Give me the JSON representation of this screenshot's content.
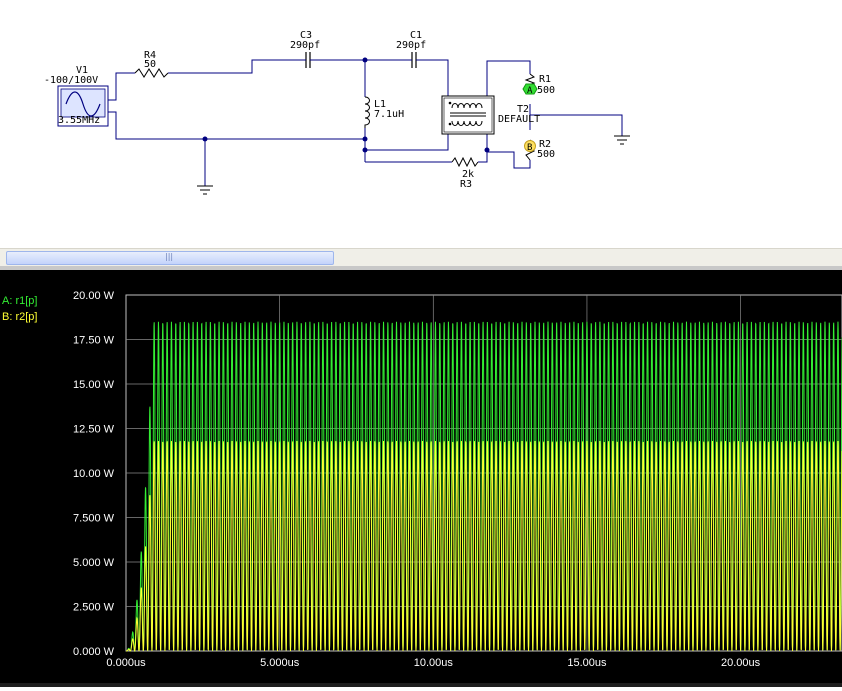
{
  "schematic": {
    "components": {
      "v1": {
        "name": "V1",
        "value": "-100/100V",
        "freq": "3.55MHz"
      },
      "r4": {
        "name": "R4",
        "value": "50"
      },
      "c3": {
        "name": "C3",
        "value": "290pf"
      },
      "c1": {
        "name": "C1",
        "value": "290pf"
      },
      "l1": {
        "name": "L1",
        "value": "7.1uH"
      },
      "t2": {
        "name": "T2",
        "value": "DEFAULT"
      },
      "r1": {
        "name": "R1",
        "value": "500"
      },
      "r2": {
        "name": "R2",
        "value": "500"
      },
      "r3": {
        "name": "R3",
        "value": "2k"
      }
    },
    "probes": {
      "a": {
        "letter": "A",
        "color": "#33dd33"
      },
      "b": {
        "letter": "B",
        "color": "#ffe060"
      }
    }
  },
  "scrollbar": {
    "grip": "|||"
  },
  "chart_data": {
    "type": "line",
    "xlabel": "",
    "ylabel": "",
    "xlim": [
      0,
      23.3
    ],
    "ylim": [
      0,
      20
    ],
    "x_ticks": [
      "0.000us",
      "5.000us",
      "10.00us",
      "15.00us",
      "20.00us"
    ],
    "y_ticks": [
      "0.000 W",
      "2.500 W",
      "5.000 W",
      "7.500 W",
      "10.00 W",
      "12.50 W",
      "15.00 W",
      "17.50 W",
      "20.00 W"
    ],
    "grid": true,
    "legend_position": "top-left",
    "series": [
      {
        "name": "A: r1[p]",
        "color": "#33ee33",
        "peak": 18.5,
        "min": 0,
        "freq_mhz": 7.1,
        "settle_us": 0.9
      },
      {
        "name": "B: r2[p]",
        "color": "#ffff33",
        "peak": 11.8,
        "min": 0,
        "freq_mhz": 7.1,
        "settle_us": 0.9
      }
    ]
  }
}
